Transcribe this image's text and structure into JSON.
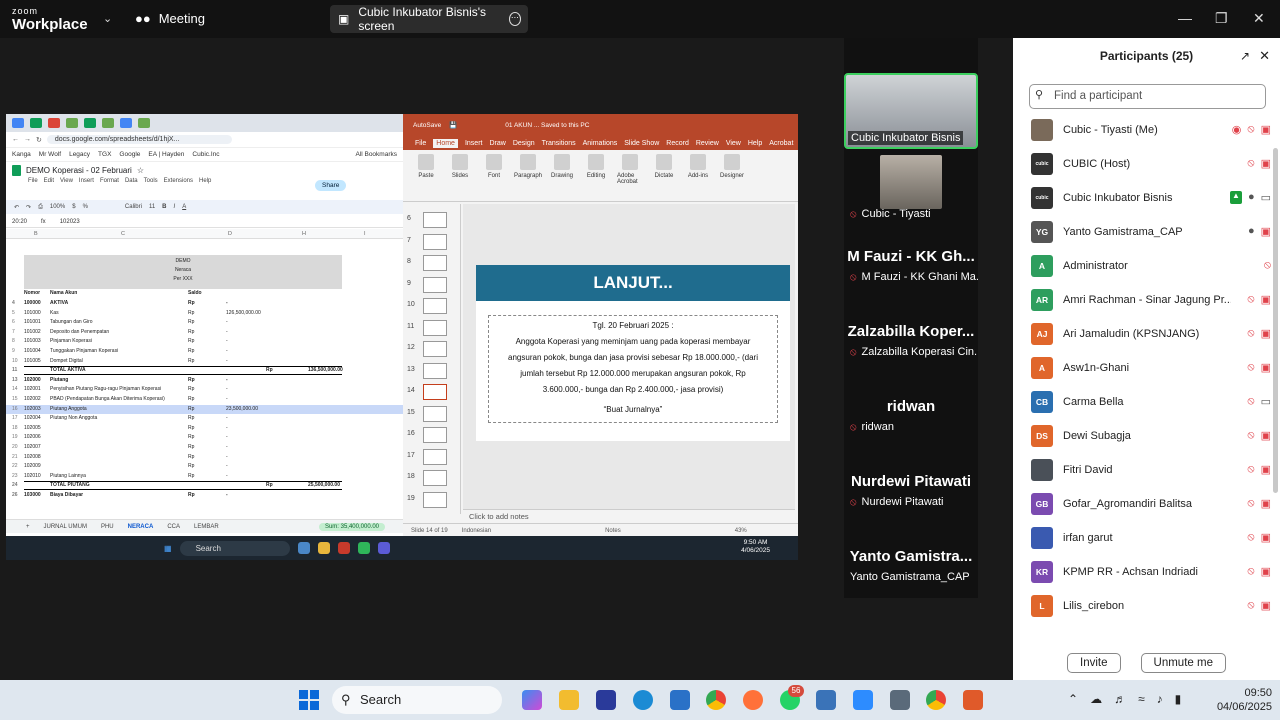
{
  "zoom": {
    "logo_line1": "zoom",
    "logo_line2": "Workplace",
    "meeting_label": "Meeting",
    "screen_title": "Cubic Inkubator Bisnis's screen"
  },
  "spreadsheet": {
    "browser_url": "docs.google.com/spreadsheets/d/1hjX...",
    "bookmarks": [
      "Kanga",
      "Mr Wolf",
      "Legacy",
      "TGX",
      "Google",
      "EA | Hayden",
      "Cubic.Inc",
      "All Bookmarks"
    ],
    "title": "DEMO Koperasi - 02 Februari",
    "menu": [
      "File",
      "Edit",
      "View",
      "Insert",
      "Format",
      "Data",
      "Tools",
      "Extensions",
      "Help"
    ],
    "share_label": "Share",
    "zoom": "100%",
    "font": "Calibri",
    "font_size": "11",
    "cell_ref": "20:20",
    "formula": "102023",
    "header_lines": [
      "DEMO",
      "Neraca",
      "Per XXX"
    ],
    "col_headers": [
      "Nomor",
      "Nama Akun",
      "Saldo"
    ],
    "rows": [
      {
        "n": "4",
        "no": "100000",
        "name": "AKTIVA",
        "cur": "Rp",
        "val": "-",
        "bold": true
      },
      {
        "n": "5",
        "no": "101000",
        "name": "Kas",
        "cur": "Rp",
        "val": "126,500,000.00"
      },
      {
        "n": "6",
        "no": "101001",
        "name": "Tabungan dan Giro",
        "cur": "Rp",
        "val": "-"
      },
      {
        "n": "7",
        "no": "101002",
        "name": "Deposito dan Penempatan",
        "cur": "Rp",
        "val": "-"
      },
      {
        "n": "8",
        "no": "101003",
        "name": "Pinjaman Koperasi",
        "cur": "Rp",
        "val": "-"
      },
      {
        "n": "9",
        "no": "101004",
        "name": "Tunggakan Pinjaman Koperasi",
        "cur": "Rp",
        "val": "-"
      },
      {
        "n": "10",
        "no": "101005",
        "name": "Dompet Digital",
        "cur": "Rp",
        "val": "-"
      },
      {
        "n": "11",
        "no": "",
        "name": "TOTAL AKTIVA",
        "cur": "Rp",
        "val": "136,500,000.00",
        "total": true
      },
      {
        "n": "13",
        "no": "102000",
        "name": "Piutang",
        "cur": "Rp",
        "val": "-",
        "bold": true
      },
      {
        "n": "14",
        "no": "102001",
        "name": "Penyisihan Piutang Ragu-ragu Pinjaman Koperasi",
        "cur": "Rp",
        "val": "-"
      },
      {
        "n": "15",
        "no": "102002",
        "name": "PBAD (Pendapatan Bunga Akan Diterima Koperasi)",
        "cur": "Rp",
        "val": "-"
      },
      {
        "n": "16",
        "no": "102003",
        "name": "Piutang Anggota",
        "cur": "Rp",
        "val": "23,500,000.00",
        "hl": true
      },
      {
        "n": "17",
        "no": "102004",
        "name": "Piutang Non Anggota",
        "cur": "Rp",
        "val": "-"
      },
      {
        "n": "18",
        "no": "102005",
        "name": "",
        "cur": "Rp",
        "val": "-"
      },
      {
        "n": "19",
        "no": "102006",
        "name": "",
        "cur": "Rp",
        "val": "-"
      },
      {
        "n": "20",
        "no": "102007",
        "name": "",
        "cur": "Rp",
        "val": "-"
      },
      {
        "n": "21",
        "no": "102008",
        "name": "",
        "cur": "Rp",
        "val": "-"
      },
      {
        "n": "22",
        "no": "102009",
        "name": "",
        "cur": "Rp",
        "val": "-"
      },
      {
        "n": "23",
        "no": "102010",
        "name": "Piutang Lainnya",
        "cur": "Rp",
        "val": "-"
      },
      {
        "n": "24",
        "no": "",
        "name": "TOTAL PIUTANG",
        "cur": "Rp",
        "val": "25,500,000.00",
        "total": true
      },
      {
        "n": "26",
        "no": "103000",
        "name": "Biaya Dibayar",
        "cur": "Rp",
        "val": "-",
        "bold": true
      }
    ],
    "tabs": [
      "JURNAL UMUM",
      "PHU",
      "NERACA",
      "CCA",
      "LEMBAR"
    ],
    "active_tab": "NERACA",
    "sum": "Sum: 35,400,000.00"
  },
  "ppt": {
    "title_bar": "01 AKUN ... Saved to this PC",
    "autosave": "AutoSave",
    "menu": [
      "File",
      "Home",
      "Insert",
      "Draw",
      "Design",
      "Transitions",
      "Animations",
      "Slide Show",
      "Record",
      "Review",
      "View",
      "Help",
      "Acrobat"
    ],
    "ribbon": [
      "Paste",
      "Slides",
      "Font",
      "Paragraph",
      "Drawing",
      "Editing",
      "Adobe Acrobat",
      "Dictate",
      "Add-ins",
      "Designer"
    ],
    "thumb_numbers": [
      "6",
      "7",
      "8",
      "9",
      "10",
      "11",
      "12",
      "13",
      "14",
      "15",
      "16",
      "17",
      "18",
      "19"
    ],
    "selected_thumb": "14",
    "slide_title": "LANJUT...",
    "slide_lines": [
      "Tgl. 20 Februari 2025 :",
      "Anggota Koperasi yang meminjam uang pada koperasi membayar",
      "angsuran pokok, bunga dan jasa provisi sebesar Rp 18.000.000,- (dari",
      "jumlah tersebut Rp 12.000.000 merupakan angsuran pokok, Rp",
      "3.600.000,- bunga dan Rp 2.400.000,- jasa provisi)",
      "“Buat Jurnalnya”"
    ],
    "notes": "Click to add notes",
    "status_slide": "Slide 14 of 19",
    "status_lang": "Indonesian",
    "status_notes": "Notes",
    "status_zoom": "43%"
  },
  "inner_taskbar": {
    "search": "Search",
    "time": "9:50 AM",
    "date": "4/06/2025"
  },
  "video_strip": [
    {
      "big": "",
      "name": "Cubic Inkubator Bisnis",
      "muted": false
    },
    {
      "big": "",
      "name": "Cubic - Tiyasti",
      "muted": true
    },
    {
      "big": "M Fauzi - KK Gh...",
      "name": "M Fauzi - KK Ghani Ma...",
      "muted": true
    },
    {
      "big": "Zalzabilla Koper...",
      "name": "Zalzabilla Koperasi Cin...",
      "muted": true
    },
    {
      "big": "ridwan",
      "name": "ridwan",
      "muted": true
    },
    {
      "big": "Nurdewi Pitawati",
      "name": "Nurdewi Pitawati",
      "muted": true
    },
    {
      "big": "Yanto Gamistra...",
      "name": "Yanto Gamistrama_CAP",
      "muted": false
    }
  ],
  "participants": {
    "title": "Participants (25)",
    "search_placeholder": "Find a participant",
    "list": [
      {
        "initials": "",
        "color": "#7a6a5a",
        "name": "Cubic - Tiyasti (Me)",
        "icons": [
          "rec",
          "mic-off",
          "vid-off"
        ]
      },
      {
        "initials": "cubic",
        "color": "#333333",
        "name": "CUBIC (Host)",
        "icons": [
          "mic-off",
          "vid-off"
        ]
      },
      {
        "initials": "cubic",
        "color": "#333333",
        "name": "Cubic Inkubator Bisnis",
        "icons": [
          "share",
          "mic",
          "vid"
        ]
      },
      {
        "initials": "YG",
        "color": "#555555",
        "name": "Yanto Gamistrama_CAP",
        "icons": [
          "mic",
          "vid-off"
        ]
      },
      {
        "initials": "A",
        "color": "#2e9e5e",
        "name": "Administrator",
        "icons": [
          "mic-off"
        ]
      },
      {
        "initials": "AR",
        "color": "#2e9e5e",
        "name": "Amri Rachman - Sinar Jagung Pr...",
        "icons": [
          "mic-off",
          "vid-off"
        ]
      },
      {
        "initials": "AJ",
        "color": "#e0662b",
        "name": "Ari Jamaludin (KPSNJANG)",
        "icons": [
          "mic-off",
          "vid-off"
        ]
      },
      {
        "initials": "A",
        "color": "#e0662b",
        "name": "Asw1n-Ghani",
        "icons": [
          "mic-off",
          "vid-off"
        ]
      },
      {
        "initials": "CB",
        "color": "#2a6fb0",
        "name": "Carma Bella",
        "icons": [
          "mic-off",
          "vid"
        ]
      },
      {
        "initials": "DS",
        "color": "#e0662b",
        "name": "Dewi Subagja",
        "icons": [
          "mic-off",
          "vid-off"
        ]
      },
      {
        "initials": "",
        "color": "#4a5058",
        "name": "Fitri David",
        "icons": [
          "mic-off",
          "vid-off"
        ]
      },
      {
        "initials": "GB",
        "color": "#7b4bb0",
        "name": "Gofar_Agromandiri Balitsa",
        "icons": [
          "mic-off",
          "vid-off"
        ]
      },
      {
        "initials": "",
        "color": "#3a5ab0",
        "name": "irfan garut",
        "icons": [
          "mic-off",
          "vid-off"
        ]
      },
      {
        "initials": "KR",
        "color": "#7b4bb0",
        "name": "KPMP RR - Achsan Indriadi",
        "icons": [
          "mic-off",
          "vid-off"
        ]
      },
      {
        "initials": "L",
        "color": "#e0662b",
        "name": "Lilis_cirebon",
        "icons": [
          "mic-off",
          "vid-off"
        ]
      }
    ],
    "invite": "Invite",
    "unmute": "Unmute me"
  },
  "taskbar": {
    "search": "Search",
    "whatsapp_badge": "56",
    "time": "09:50",
    "date": "04/06/2025"
  },
  "colors": {
    "zoom_dark": "#121212",
    "ppt_accent": "#b7472a",
    "slide_header": "#1f6c8e",
    "mute_red": "#e0424b",
    "active_green": "#3ccf5f"
  }
}
